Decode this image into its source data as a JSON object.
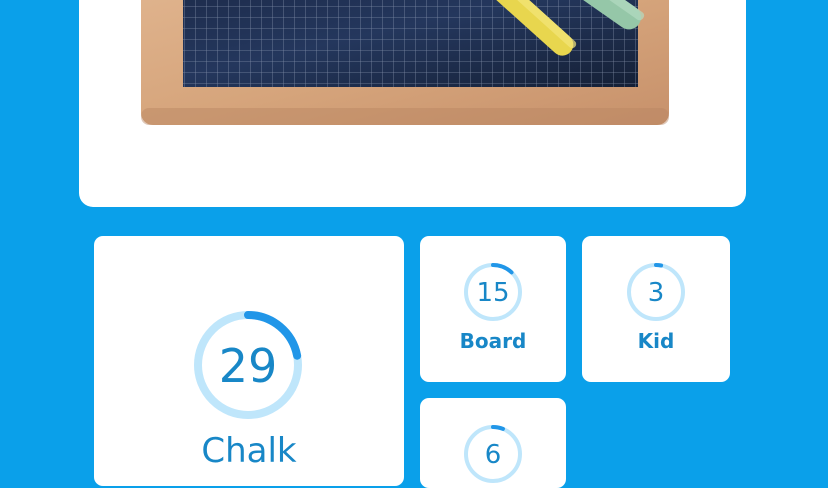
{
  "image_card": {
    "picture": "slate-with-chalk"
  },
  "answers": [
    {
      "count": "29",
      "word": "Chalk",
      "progress": 0.22
    },
    {
      "count": "15",
      "word": "Board",
      "progress": 0.12
    },
    {
      "count": "3",
      "word": "Kid",
      "progress": 0.03
    },
    {
      "count": "6",
      "word": "",
      "progress": 0.06
    }
  ],
  "colors": {
    "background": "#0aa0ea",
    "card": "#ffffff",
    "text": "#1887c7",
    "ring_track": "#bfe6fb",
    "ring_fill": "#2196e8"
  }
}
